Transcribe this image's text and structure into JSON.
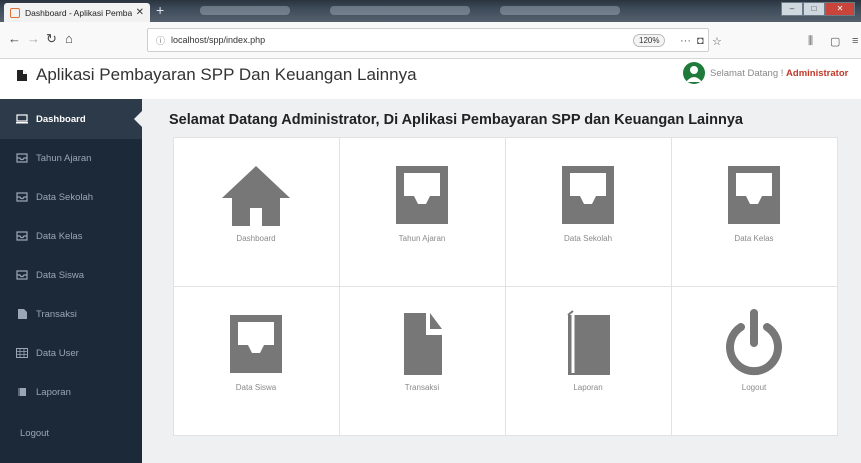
{
  "browser": {
    "tab_title": "Dashboard - Aplikasi Pembaya",
    "url": "localhost/spp/index.php",
    "zoom": "120%"
  },
  "header": {
    "app_title": "Aplikasi Pembayaran SPP Dan Keuangan Lainnya",
    "welcome_prefix": "Selamat Datang ! ",
    "welcome_user": "Administrator"
  },
  "sidebar": {
    "items": [
      {
        "label": "Dashboard",
        "icon": "monitor-icon",
        "active": true
      },
      {
        "label": "Tahun Ajaran",
        "icon": "inbox-icon"
      },
      {
        "label": "Data Sekolah",
        "icon": "inbox-icon"
      },
      {
        "label": "Data Kelas",
        "icon": "inbox-icon"
      },
      {
        "label": "Data Siswa",
        "icon": "inbox-icon"
      },
      {
        "label": "Transaksi",
        "icon": "file-icon"
      },
      {
        "label": "Data User",
        "icon": "table-icon"
      },
      {
        "label": "Laporan",
        "icon": "book-icon"
      },
      {
        "label": "Logout",
        "icon": ""
      }
    ]
  },
  "main": {
    "title": "Selamat Datang Administrator, Di Aplikasi Pembayaran SPP dan Keuangan Lainnya",
    "tiles": [
      {
        "label": "Dashboard",
        "icon": "home-icon"
      },
      {
        "label": "Tahun Ajaran",
        "icon": "inbox-icon"
      },
      {
        "label": "Data Sekolah",
        "icon": "inbox-icon"
      },
      {
        "label": "Data Kelas",
        "icon": "inbox-icon"
      },
      {
        "label": "Data Siswa",
        "icon": "inbox-icon"
      },
      {
        "label": "Transaksi",
        "icon": "file-icon"
      },
      {
        "label": "Laporan",
        "icon": "book-icon"
      },
      {
        "label": "Logout",
        "icon": "power-icon"
      }
    ]
  },
  "colors": {
    "sidebar_bg": "#1c2938",
    "content_bg": "#eef0f2",
    "tile_icon": "#777777",
    "accent_user": "#c0392b",
    "avatar": "#1f7a3b"
  }
}
